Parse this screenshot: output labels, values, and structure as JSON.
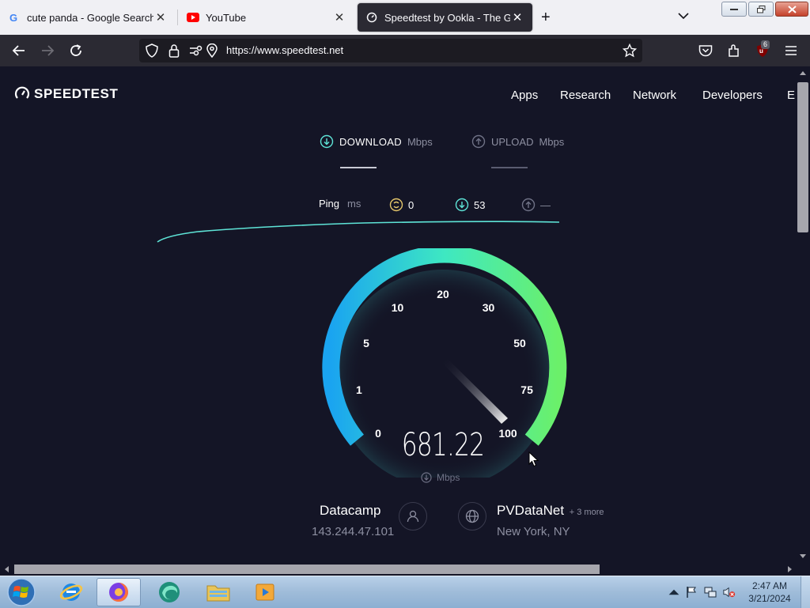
{
  "browser": {
    "tabs": [
      {
        "title": "cute panda - Google Search",
        "icon": "google-icon",
        "active": false
      },
      {
        "title": "YouTube",
        "icon": "youtube-icon",
        "active": false
      },
      {
        "title": "Speedtest by Ookla - The Global Broadband Speed Test",
        "icon": "speedtest-icon",
        "active": true
      }
    ],
    "new_tab_label": "+",
    "url": "https://www.speedtest.net",
    "extension_badge": "6"
  },
  "site": {
    "logo_text": "SPEEDTEST",
    "nav": [
      "Apps",
      "Research",
      "Network",
      "Developers",
      "Er"
    ]
  },
  "test": {
    "download_tab": {
      "label": "DOWNLOAD",
      "unit": "Mbps"
    },
    "upload_tab": {
      "label": "UPLOAD",
      "unit": "Mbps"
    },
    "ping": {
      "label": "Ping",
      "unit": "ms",
      "idle": "0",
      "download": "53",
      "upload": "—"
    },
    "gauge_ticks": [
      "0",
      "1",
      "5",
      "10",
      "20",
      "30",
      "50",
      "75",
      "100"
    ],
    "current_speed": "681.22",
    "speed_unit": "Mbps"
  },
  "server": {
    "isp_name": "Datacamp",
    "ip": "143.244.47.101",
    "host_name": "PVDataNet",
    "more": "+ 3 more",
    "location": "New York, NY"
  },
  "taskbar": {
    "time": "2:47 AM",
    "date": "3/21/2024"
  },
  "colors": {
    "page_bg": "#141526",
    "gauge_start": "#1aa4f0",
    "gauge_mid": "#3ee8c2",
    "gauge_end": "#6bf06a",
    "accent": "#5ee4d7"
  }
}
